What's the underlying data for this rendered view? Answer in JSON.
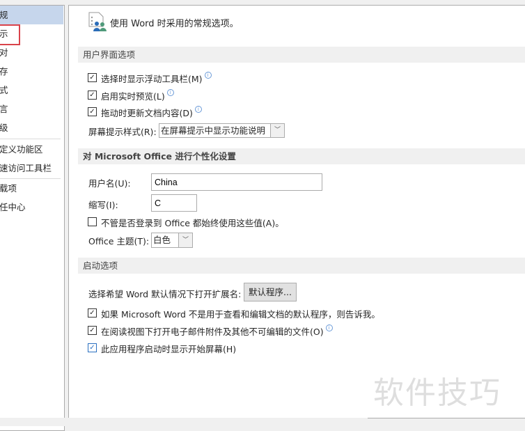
{
  "sidebar": {
    "items": [
      "规",
      "示",
      "对",
      "存",
      "式",
      "言",
      "级",
      "定义功能区",
      "速访问工具栏",
      "载项",
      "任中心"
    ]
  },
  "main": {
    "intro": "使用 Word 时采用的常规选项。",
    "ui_section": {
      "title": "用户界面选项",
      "options": [
        {
          "label": "选择时显示浮动工具栏(M)",
          "checked": true
        },
        {
          "label": "启用实时预览(L)",
          "checked": true
        },
        {
          "label": "拖动时更新文档内容(D)",
          "checked": true
        }
      ],
      "screentip_label": "屏幕提示样式(R):",
      "screentip_value": "在屏幕提示中显示功能说明"
    },
    "personalize": {
      "title": "对 Microsoft Office 进行个性化设置",
      "username_label": "用户名(U):",
      "username": "China",
      "initials_label": "缩写(I):",
      "initials": "C",
      "always_use": {
        "label": "不管是否登录到 Office 都始终使用这些值(A)。",
        "checked": false
      },
      "theme_label": "Office 主题(T):",
      "theme_value": "白色"
    },
    "startup": {
      "title": "启动选项",
      "ext_label": "选择希望 Word 默认情况下打开扩展名:",
      "default_button": "默认程序...",
      "options": [
        {
          "label": "如果 Microsoft Word 不是用于查看和编辑文档的默认程序，则告诉我。",
          "checked": true
        },
        {
          "label": "在阅读视图下打开电子邮件附件及其他不可编辑的文件(O)",
          "checked": true
        },
        {
          "label": "此应用程序启动时显示开始屏幕(H)",
          "checked": true
        }
      ]
    }
  },
  "watermark": "软件技巧"
}
